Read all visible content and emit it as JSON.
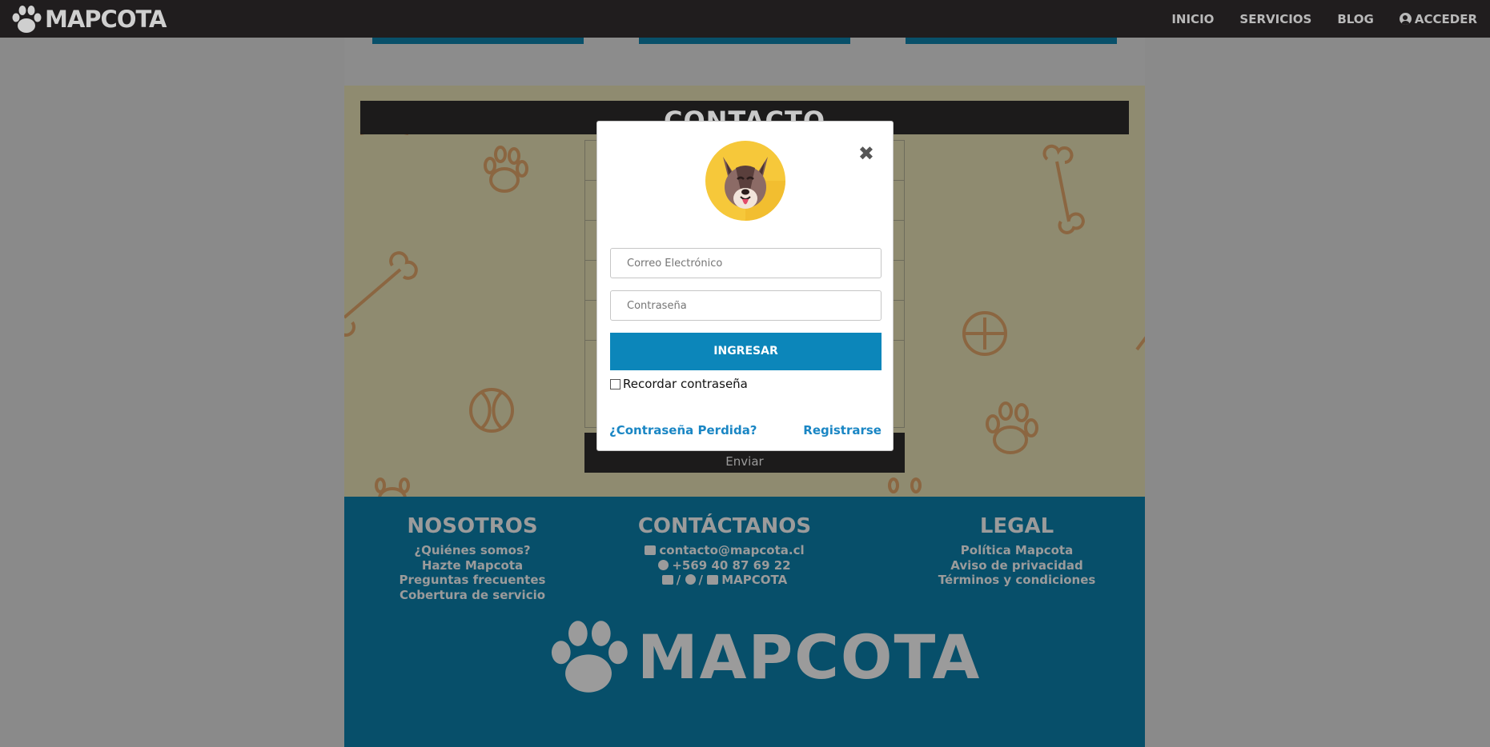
{
  "nav": {
    "brand": "MAPCOTA",
    "links": [
      "INICIO",
      "SERVICIOS",
      "BLOG"
    ],
    "account": "ACCEDER"
  },
  "contact": {
    "title": "CONTACTO",
    "send_label": "Enviar"
  },
  "modal": {
    "email_placeholder": "Correo Electrónico",
    "password_placeholder": "Contraseña",
    "login_label": "INGRESAR",
    "remember_label": "Recordar contraseña",
    "lost_password": "¿Contraseña Perdida?",
    "register": "Registrarse"
  },
  "footer": {
    "about": {
      "title": "NOSOTROS",
      "items": [
        "¿Quiénes somos?",
        "Hazte Mapcota",
        "Preguntas frecuentes",
        "Cobertura de servicio"
      ]
    },
    "contact": {
      "title": "CONTÁCTANOS",
      "email": "contacto@mapcota.cl",
      "phone": "+569 40 87 69 22",
      "social_sep": "/",
      "social_handle": "MAPCOTA"
    },
    "legal": {
      "title": "LEGAL",
      "items": [
        "Política Mapcota",
        "Aviso de privacidad",
        "Términos y condiciones"
      ]
    },
    "brand": "MAPCOTA"
  },
  "colors": {
    "navbar": "#201d1e",
    "footer": "#074f6a",
    "primary_button": "#0c86ba",
    "link": "#1a86c4"
  }
}
